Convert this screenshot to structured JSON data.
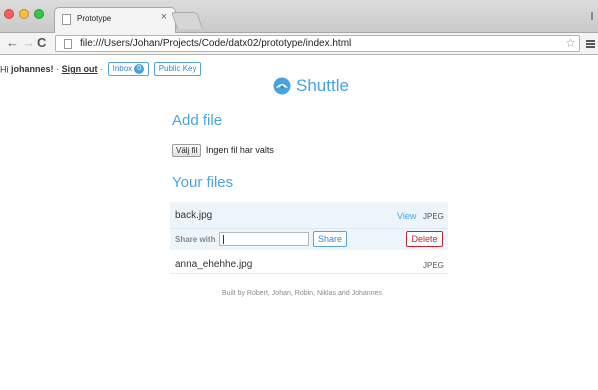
{
  "browser": {
    "tab_title": "Prototype",
    "tab_close": "×",
    "url": "file:///Users/Johan/Projects/Code/datx02/prototype/index.html",
    "icons": [
      "close-window-icon",
      "minimize-window-icon",
      "maximize-window-icon",
      "page-icon",
      "back-arrow-icon",
      "forward-arrow-icon",
      "reload-icon",
      "star-icon",
      "menu-icon"
    ],
    "star": "☆"
  },
  "userbar": {
    "greeting": "Hi",
    "username": "johannes!",
    "separator1": "·",
    "sign_out": "Sign out",
    "separator2": "·",
    "inbox_label": "Inbox",
    "inbox_count": "0",
    "public_key": "Public Key"
  },
  "brand": {
    "name": "Shuttle",
    "color": "#47a2e0"
  },
  "add_file": {
    "title": "Add file",
    "choose_button": "Välj fil",
    "status": "Ingen fil har valts"
  },
  "files": {
    "title": "Your files",
    "items": [
      {
        "name": "back.jpg",
        "view": "View",
        "type": "JPEG",
        "share_label": "Share with",
        "share_value": "",
        "share_button": "Share",
        "delete_button": "Delete"
      },
      {
        "name": "anna_ehehhe.jpg",
        "type": "JPEG"
      }
    ]
  },
  "footer": "Built by Robert, Johan, Robin, Niklas and Johannes",
  "colors": {
    "accent": "#49a5e1",
    "selected_row": "#edf5fb",
    "danger": "#c0272d"
  }
}
